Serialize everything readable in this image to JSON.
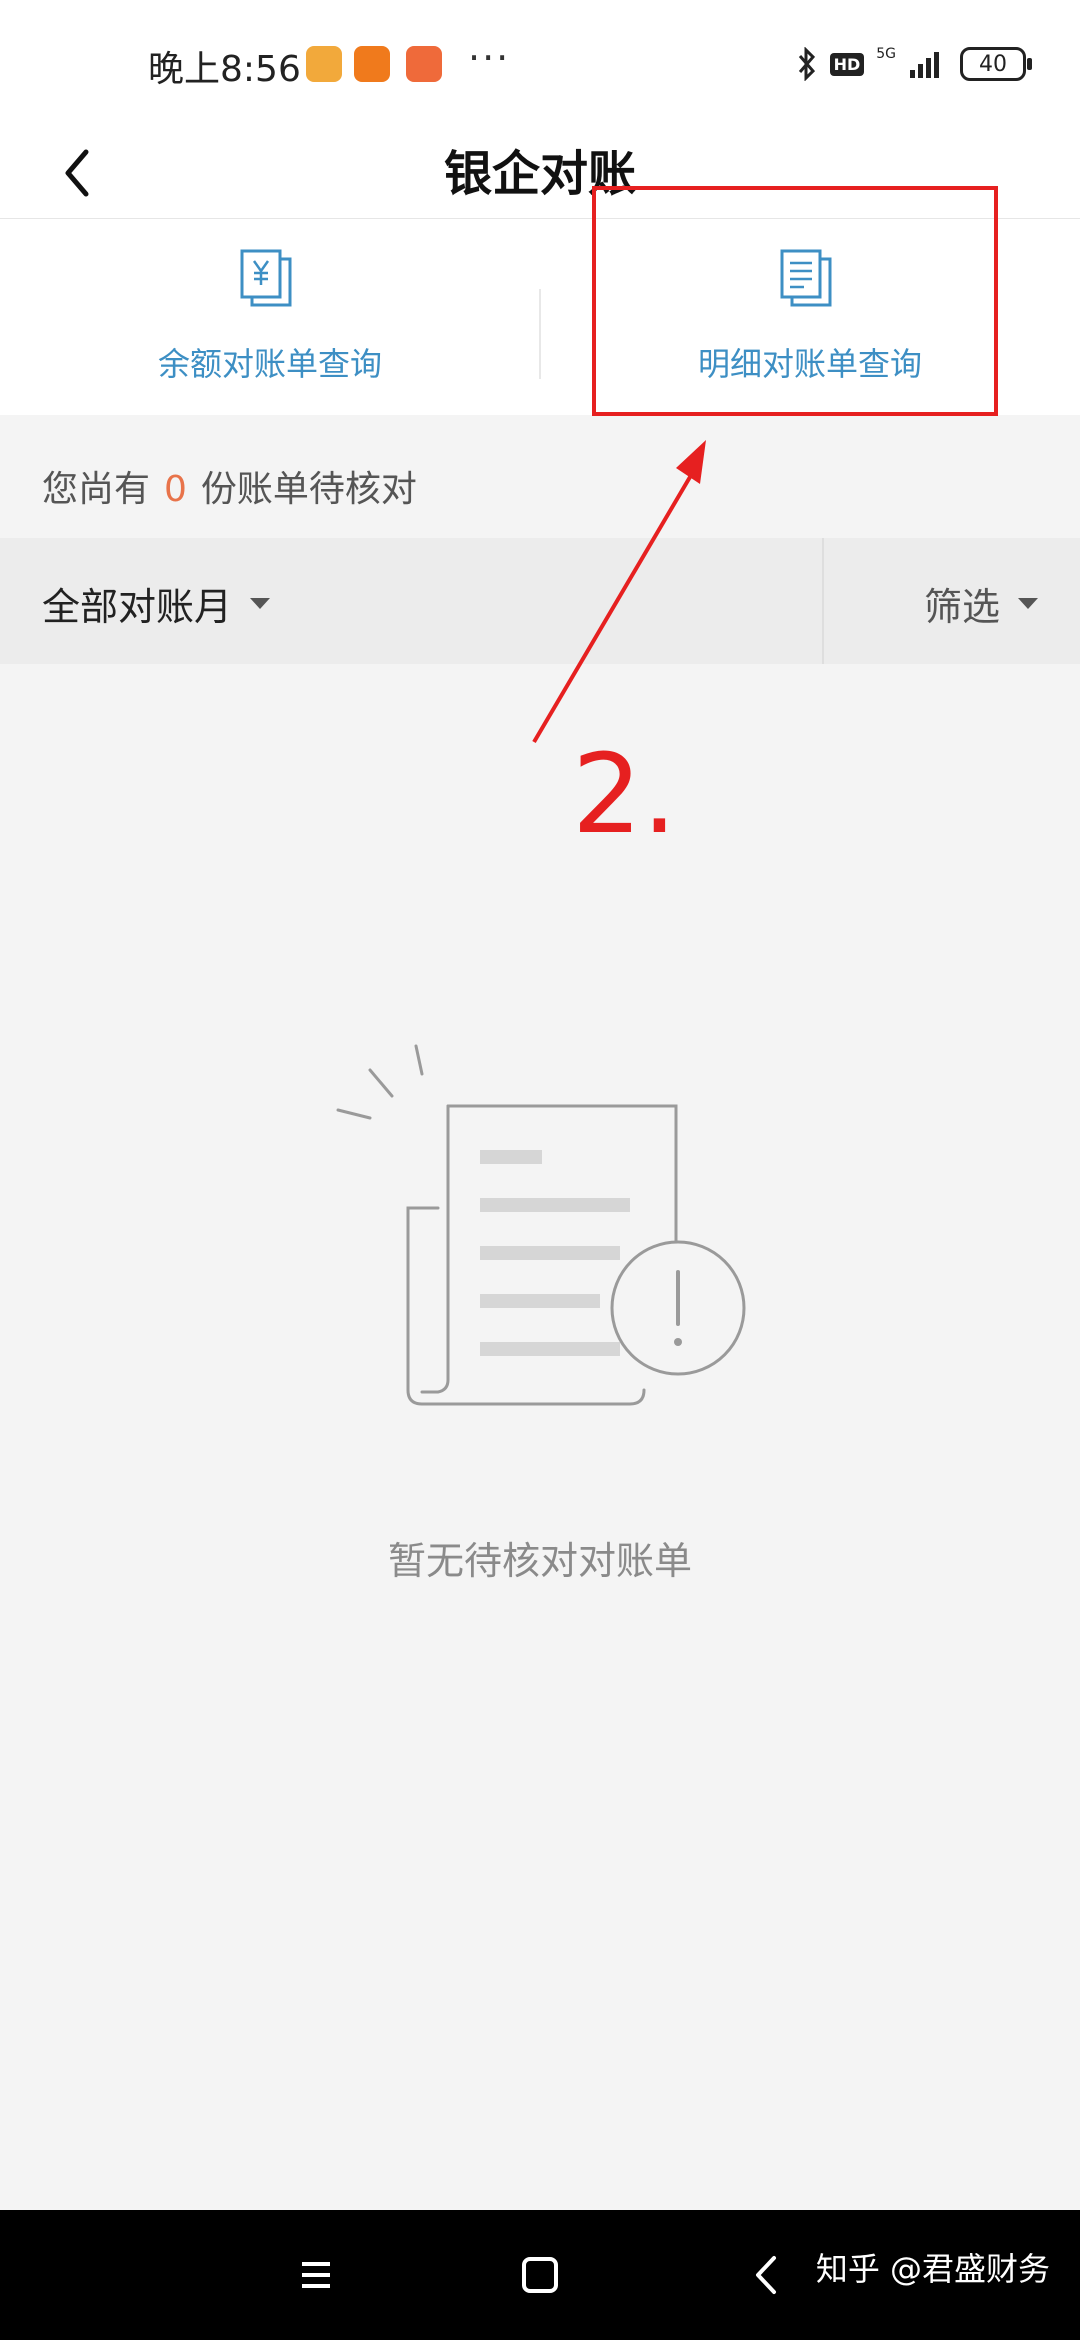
{
  "status_bar": {
    "time": "晚上8:56",
    "more": "···",
    "hd": "HD",
    "network": "5G",
    "battery": "40"
  },
  "header": {
    "title": "银企对账"
  },
  "entries": [
    {
      "label": "余额对账单查询",
      "icon": "yuan-document-icon"
    },
    {
      "label": "明细对账单查询",
      "icon": "list-document-icon"
    }
  ],
  "annotation": {
    "step_label": "2.",
    "color": "#e62020"
  },
  "pending": {
    "prefix": "您尚有",
    "count": "0",
    "suffix": "份账单待核对"
  },
  "filters": {
    "month_label": "全部对账月",
    "screen_label": "筛选"
  },
  "empty_state": {
    "message": "暂无待核对对账单"
  },
  "watermark": "知乎 @君盛财务",
  "colors": {
    "accent_blue": "#3d8fc4",
    "count_orange": "#e8734a",
    "annotation_red": "#e62020"
  }
}
